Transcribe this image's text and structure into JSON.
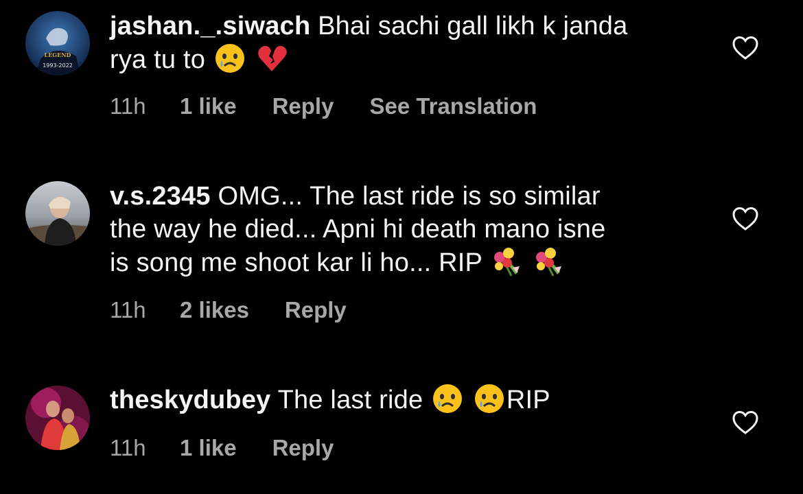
{
  "comments": [
    {
      "username": "jashan._.siwach",
      "text_line1": "Bhai sachi gall likh k janda",
      "text_line2": "rya tu to",
      "emojis": [
        "crying-face",
        "broken-heart"
      ],
      "avatar_text_top": "LEGEND",
      "avatar_text_bottom": "1993-2022",
      "time": "11h",
      "likes": "1 like",
      "reply": "Reply",
      "translation": "See Translation"
    },
    {
      "username": "v.s.2345",
      "text_line1": "OMG... The last ride is so similar",
      "text_line2": "the way he died... Apni hi death mano isne",
      "text_line3": "is song me shoot kar li ho... RIP",
      "emojis": [
        "bouquet",
        "bouquet"
      ],
      "time": "11h",
      "likes": "2 likes",
      "reply": "Reply"
    },
    {
      "username": "theskydubey",
      "text_line1": "The last ride",
      "text_after_emojis": "RIP",
      "emojis": [
        "crying-face",
        "crying-face"
      ],
      "time": "11h",
      "likes": "1 like",
      "reply": "Reply"
    }
  ],
  "colors": {
    "background": "#000000",
    "primary_text": "#f5f5f5",
    "secondary_text": "#a8a8a8"
  },
  "icons": {
    "like": "heart-outline-icon"
  }
}
